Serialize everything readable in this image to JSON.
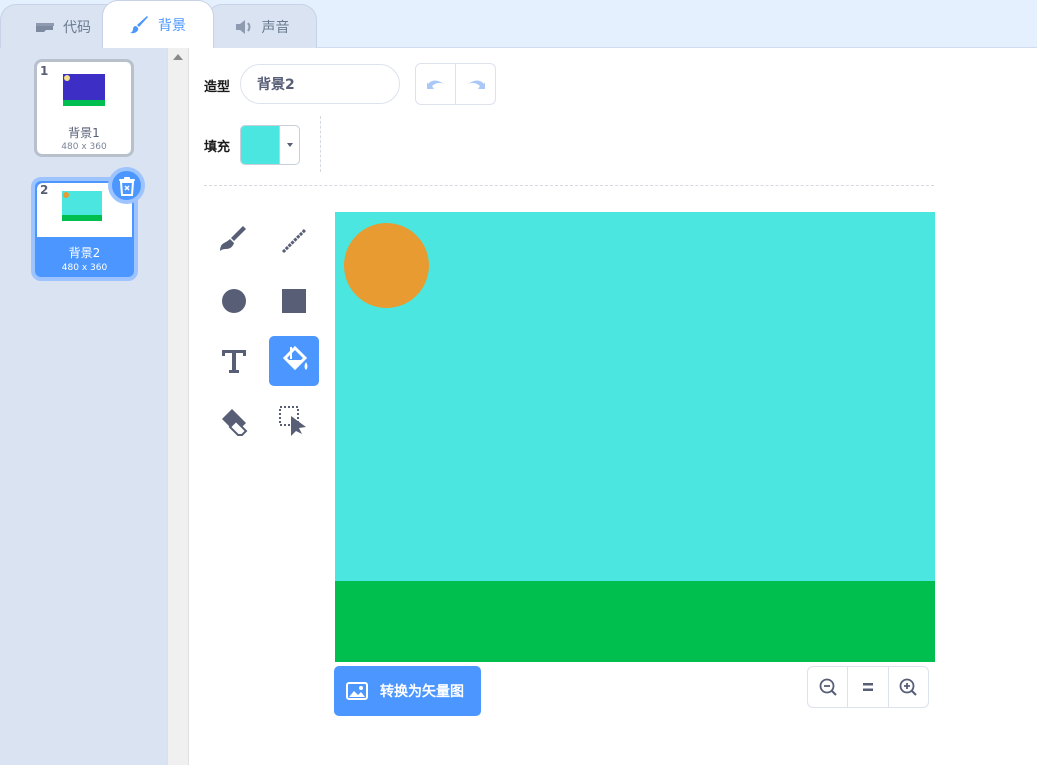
{
  "tabs": [
    {
      "label": "代码",
      "icon": "code-icon"
    },
    {
      "label": "背景",
      "icon": "brush-icon",
      "active": true
    },
    {
      "label": "声音",
      "icon": "speaker-icon"
    }
  ],
  "costumes": [
    {
      "number": "1",
      "name": "背景1",
      "size": "480 x 360"
    },
    {
      "number": "2",
      "name": "背景2",
      "size": "480 x 360",
      "selected": true
    }
  ],
  "editor": {
    "costume_label": "造型",
    "costume_name": "背景2",
    "fill_label": "填充",
    "fill_color": "#4be6e0"
  },
  "tools": [
    "brush-icon",
    "line-icon",
    "circle-icon",
    "rectangle-icon",
    "text-icon",
    "fill-icon",
    "eraser-icon",
    "select-icon"
  ],
  "active_tool": "fill-icon",
  "canvas": {
    "sky_color": "#4be6e0",
    "sun_color": "#e89b30",
    "ground_color": "#00bf4f"
  },
  "convert_button": "转换为矢量图",
  "zoom": {
    "out": "zoom-out-icon",
    "reset": "zoom-reset-icon",
    "in": "zoom-in-icon"
  },
  "colors": {
    "accent": "#4c97ff",
    "panel": "#d9e3f2",
    "tabbar": "#e5f0ff"
  }
}
